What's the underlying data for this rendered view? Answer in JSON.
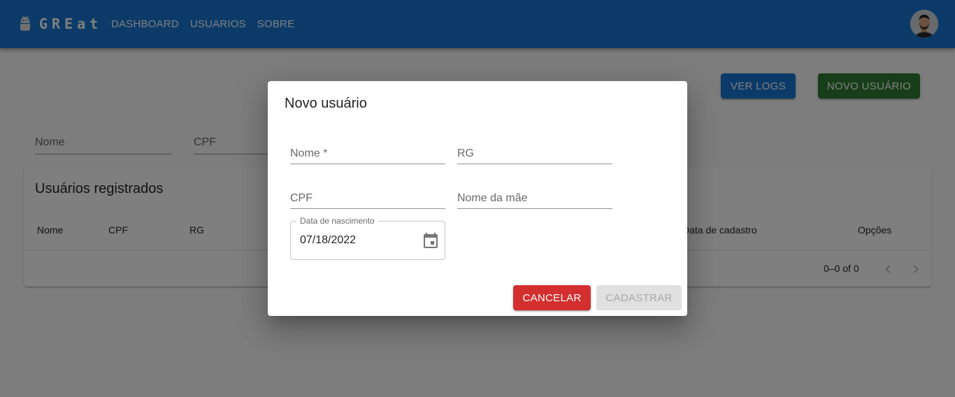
{
  "app": {
    "logo_text": "GREat",
    "logo_icon": "android-icon",
    "nav": [
      "DASHBOARD",
      "USUARIOS",
      "SOBRE"
    ],
    "avatar": "user-avatar"
  },
  "actions": {
    "logs_label": "VER LOGS",
    "new_user_label": "NOVO USUÁRIO"
  },
  "filters": {
    "nome_placeholder": "Nome",
    "cpf_placeholder": "CPF"
  },
  "table": {
    "title": "Usuários registrados",
    "columns": [
      "Nome",
      "CPF",
      "RG",
      "Data de cadastro",
      "Opções"
    ],
    "pagination": "0–0 of 0"
  },
  "dialog": {
    "title": "Novo usuário",
    "fields": {
      "nome": "Nome *",
      "rg": "RG",
      "cpf": "CPF",
      "nome_mae": "Nome da mãe"
    },
    "birthdate": {
      "label": "Data de nascimento",
      "value": "07/18/2022"
    },
    "cancel_label": "CANCELAR",
    "submit_label": "CADASTRAR"
  },
  "colors": {
    "primary": "#1976d2",
    "success": "#2e7d32",
    "error": "#d32f2f"
  }
}
